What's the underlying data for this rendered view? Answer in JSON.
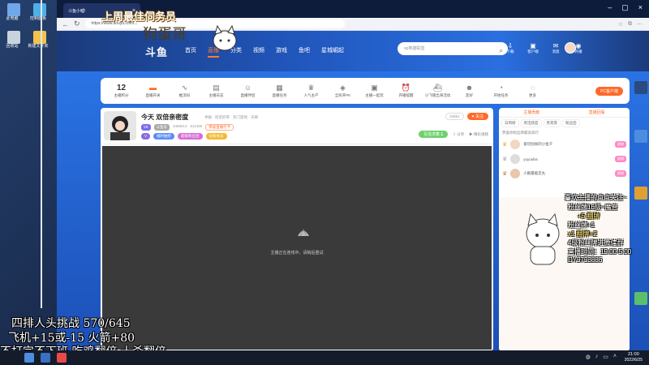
{
  "overlay": {
    "banner_title": "上周最佳伺务员",
    "handwritten": "狗蛋哥",
    "challenge_line": "四排人头挑战 570/645",
    "rules_line": "飞机+15或-15 火箭+80",
    "promise_line": "不打完不下班 吃鸡翻倍 十杀翻倍",
    "right_lines": [
      "喜欢主播的点点关注~",
      "粉丝牌16级~魔音",
      "+5 翻牌",
      "粉丝牌+1",
      "x1 翻牌+2",
      "4级粉丝牌进微信群",
      "直播时间：19:00-5:00",
      "DY9793886"
    ]
  },
  "desktop": {
    "icons": [
      {
        "label": "此电脑",
        "icon": "computer-icon"
      },
      {
        "label": "控制面板",
        "icon": "control-panel-icon"
      },
      {
        "label": "回收站",
        "icon": "recycle-bin-icon"
      },
      {
        "label": "新建文件夹",
        "icon": "folder-icon"
      }
    ]
  },
  "browser": {
    "tab_title": "斗鱼小嘘!",
    "url": "https://www.douyu.com/..."
  },
  "site": {
    "logo": "斗鱼",
    "nav": [
      "首页",
      "直播",
      "分类",
      "视频",
      "游戏",
      "鱼吧",
      "星城崛起"
    ],
    "active_nav": "直播",
    "search_placeholder": "sp英雄联盟",
    "user_items": [
      {
        "icon": "clock-icon",
        "label": "历史"
      },
      {
        "label": "关注",
        "icon": "heart-icon"
      },
      {
        "label": "下载",
        "icon": "download-icon"
      },
      {
        "label": "客户端",
        "icon": "client-icon"
      },
      {
        "icon": "message-icon",
        "label": "消息"
      },
      {
        "label": "开播",
        "icon": "broadcast-icon"
      }
    ]
  },
  "toolbar": {
    "points_value": "12",
    "points_label": "主播积分",
    "items": [
      {
        "label": "直播开关",
        "icon": "toggle-icon"
      },
      {
        "label": "推流码",
        "icon": "wave-icon"
      },
      {
        "label": "主播日志",
        "icon": "calendar-icon"
      },
      {
        "label": "直播伴侣",
        "icon": "companion-icon"
      },
      {
        "label": "直播任务",
        "icon": "gift-icon"
      },
      {
        "label": "人气主产",
        "icon": "crown-icon"
      },
      {
        "label": "全民开PK",
        "icon": "pk-icon"
      },
      {
        "label": "主播一起玩",
        "icon": "play-icon"
      },
      {
        "label": "开播提醒",
        "icon": "alarm-icon"
      },
      {
        "label": "小飞猪出海活动",
        "icon": "ship-icon"
      },
      {
        "label": "友好",
        "icon": "friend-icon"
      },
      {
        "label": "开始任务",
        "icon": "task-icon"
      },
      {
        "label": "更多",
        "icon": "more-icon"
      }
    ],
    "pc_client": "PC客户端"
  },
  "room": {
    "title": "今天 双倍亲密度",
    "meta": "举报 · 阿诺奶茶 · 热门游戏 · 天梯",
    "badges": [
      {
        "text": "V8",
        "color": "#7a6cf0"
      },
      {
        "text": "斗鱼号",
        "color": "#aaaaaa"
      }
    ],
    "room_no": "3488513",
    "fans": "511359",
    "live_tag": "恭喜直播打卡",
    "tags": [
      {
        "text": "福利抽奖",
        "color": "#5b8cf5"
      },
      {
        "text": "超级粉丝团",
        "color": "#d66bd6"
      },
      {
        "text": "钻粉会员",
        "color": "#f5b82e"
      }
    ],
    "follow_count": "34861",
    "follow_btn": "关注",
    "seek_btn": "写信求着",
    "seek_num": "1",
    "share": "分享",
    "report": "精彩视频",
    "player_status": "主播正在连线中，请稍后重试"
  },
  "rpanel": {
    "tabs": [
      "主播贡献",
      "直播回看"
    ],
    "subtabs": [
      "日周榜",
      "周活跃度",
      "贵宾席",
      "粉丝团"
    ],
    "notice": "恭喜你粉丝牌最高排行",
    "ranks": [
      {
        "name": "爱玩别闹的小鱼干",
        "badge": "超燃"
      },
      {
        "name": "yoyoshis",
        "badge": "超燃"
      },
      {
        "name": "小鹅最能走丸",
        "badge": "超燃"
      }
    ]
  },
  "taskbar": {
    "time": "21:00",
    "date": "2022/6/25"
  },
  "colors": {
    "accent": "#ff6a2a",
    "nav_blue": "#2156bc",
    "player_bg": "#3a3a3a"
  }
}
